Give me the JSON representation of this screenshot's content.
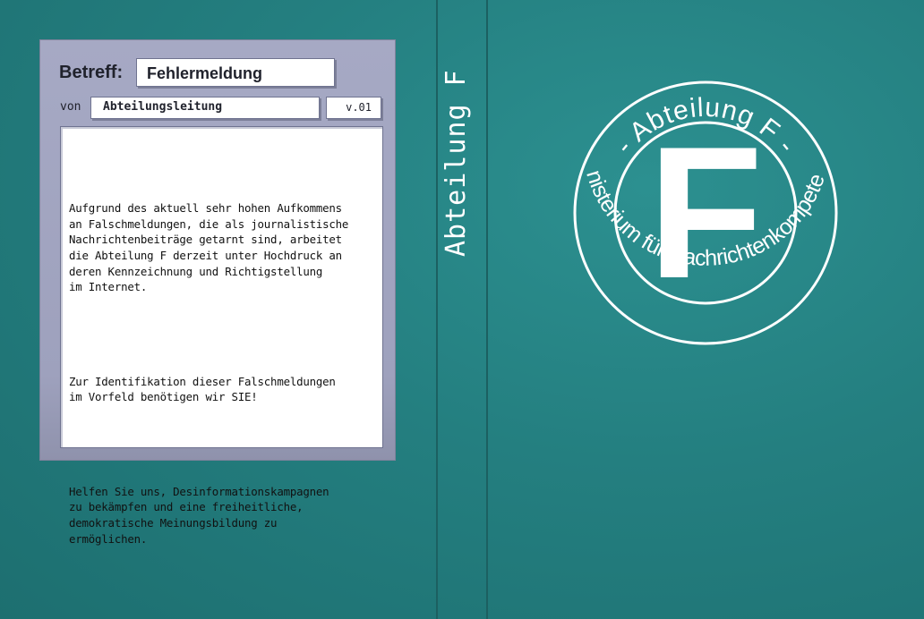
{
  "memo": {
    "subject_label": "Betreff:",
    "subject_value": "Fehlermeldung",
    "from_label": "von",
    "from_value": "Abteilungsleitung",
    "version": "v.01",
    "paragraphs": [
      "Aufgrund des aktuell sehr hohen Aufkommens\nan Falschmeldungen, die als journalistische\nNachrichtenbeiträge getarnt sind, arbeitet\ndie Abteilung F derzeit unter Hochdruck an\nderen Kennzeichnung und Richtigstellung\nim Internet.",
      "Zur Identifikation dieser Falschmeldungen\nim Vorfeld benötigen wir SIE!",
      "Helfen Sie uns, Desinformationskampagnen\nzu bekämpfen und eine freiheitliche,\ndemokratische Meinungsbildung zu\nermöglichen."
    ]
  },
  "spine": {
    "title": "Abteilung F"
  },
  "seal": {
    "letter": "F",
    "top_arc": "- Abteilung F -",
    "bottom_arc": "Ministerium für Nachrichtenkompetenz"
  },
  "colors": {
    "background": "#247f80",
    "panel": "#a6a9c4",
    "seal": "#ffffff"
  }
}
